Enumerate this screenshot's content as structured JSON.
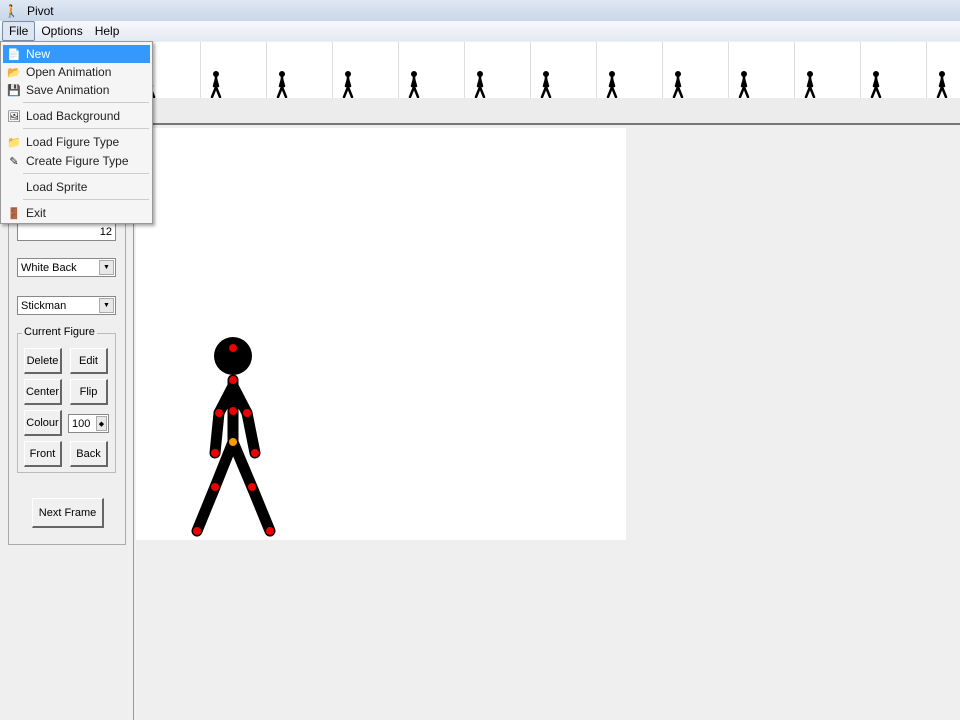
{
  "window": {
    "title": "Pivot"
  },
  "menubar": [
    "File",
    "Options",
    "Help"
  ],
  "file_menu": [
    {
      "label": "New",
      "icon": "new-page-icon",
      "selected": true
    },
    {
      "label": "Open Animation",
      "icon": "open-icon"
    },
    {
      "label": "Save Animation",
      "icon": "save-icon"
    },
    {
      "label": "Load Background",
      "icon": "background-icon"
    },
    {
      "label": "Load Figure Type",
      "icon": "figure-type-icon"
    },
    {
      "label": "Create Figure Type",
      "icon": "create-figure-icon"
    },
    {
      "label": "Load Sprite",
      "icon": ""
    },
    {
      "label": "Exit",
      "icon": "exit-icon"
    }
  ],
  "panel": {
    "speed_value": "12",
    "background_select": "White Back",
    "figure_select": "Stickman",
    "group_label": "Current Figure",
    "buttons": [
      "Delete",
      "Edit",
      "Center",
      "Flip",
      "Colour",
      "Front",
      "Back"
    ],
    "alpha_value": "100",
    "next_frame": "Next Frame"
  },
  "frames_count": 13
}
